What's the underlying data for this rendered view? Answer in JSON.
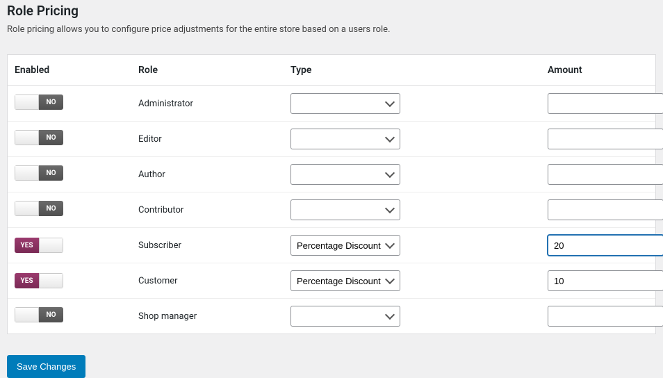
{
  "page": {
    "title": "Role Pricing",
    "description": "Role pricing allows you to configure price adjustments for the entire store based on a users role."
  },
  "columns": {
    "enabled": "Enabled",
    "role": "Role",
    "type": "Type",
    "amount": "Amount"
  },
  "toggle_text": {
    "on": "YES",
    "off": "NO"
  },
  "type_options": [
    "",
    "Percentage Discount"
  ],
  "rows": [
    {
      "enabled": false,
      "role": "Administrator",
      "type": "",
      "amount": ""
    },
    {
      "enabled": false,
      "role": "Editor",
      "type": "",
      "amount": ""
    },
    {
      "enabled": false,
      "role": "Author",
      "type": "",
      "amount": ""
    },
    {
      "enabled": false,
      "role": "Contributor",
      "type": "",
      "amount": ""
    },
    {
      "enabled": true,
      "role": "Subscriber",
      "type": "Percentage Discount",
      "amount": "20",
      "focused": true
    },
    {
      "enabled": true,
      "role": "Customer",
      "type": "Percentage Discount",
      "amount": "10"
    },
    {
      "enabled": false,
      "role": "Shop manager",
      "type": "",
      "amount": ""
    }
  ],
  "buttons": {
    "save": "Save Changes"
  }
}
